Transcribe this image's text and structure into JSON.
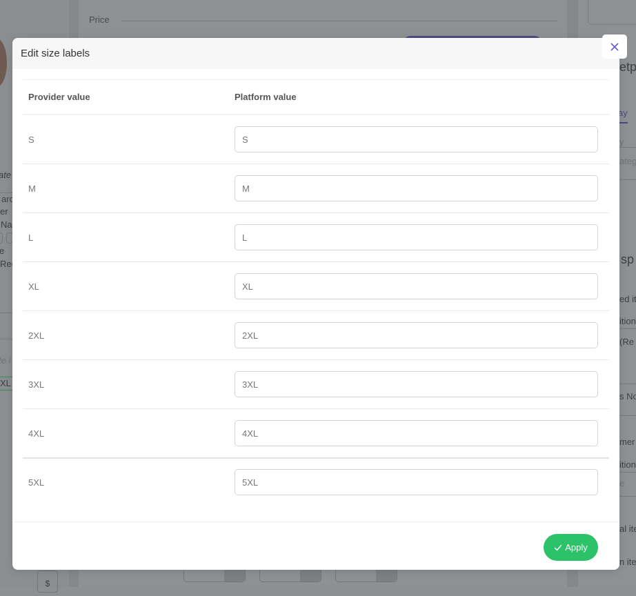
{
  "background": {
    "price_label": "Price",
    "right_fragments": [
      "etp",
      "ay",
      "y",
      "atego",
      "sp",
      "ed it",
      "ition",
      "(Re",
      "s No",
      "mer",
      "ition",
      "e",
      "al ite",
      "n ite"
    ],
    "left_fragments": [
      "ate",
      "arc",
      "er",
      "Na",
      "e",
      "Rec",
      "te i",
      "XL"
    ],
    "currency_symbol": "$"
  },
  "modal": {
    "title": "Edit size labels",
    "close_icon": "close-icon",
    "columns": {
      "provider": "Provider value",
      "platform": "Platform value"
    },
    "rows": [
      {
        "provider": "S",
        "platform": "S"
      },
      {
        "provider": "M",
        "platform": "M"
      },
      {
        "provider": "L",
        "platform": "L"
      },
      {
        "provider": "XL",
        "platform": "XL"
      },
      {
        "provider": "2XL",
        "platform": "2XL"
      },
      {
        "provider": "3XL",
        "platform": "3XL"
      },
      {
        "provider": "4XL",
        "platform": "4XL"
      },
      {
        "provider": "5XL",
        "platform": "5XL"
      }
    ],
    "apply_label": "Apply",
    "apply_icon": "check-icon",
    "colors": {
      "accent": "#6a5fd6",
      "apply_green": "#2cc26a"
    }
  }
}
